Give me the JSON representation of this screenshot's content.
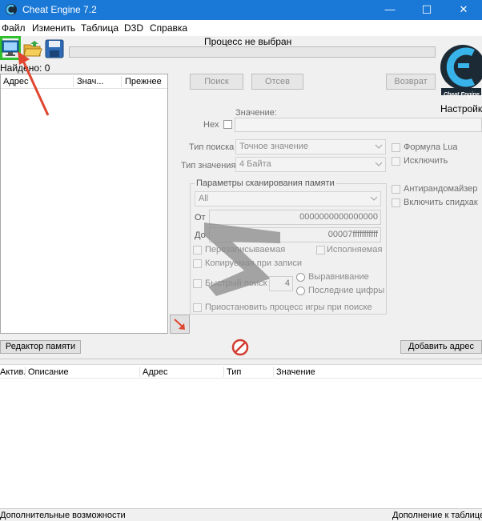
{
  "window": {
    "title": "Cheat Engine 7.2",
    "minimize": "—",
    "maximize": "☐",
    "close": "✕"
  },
  "menu": [
    "Файл",
    "Изменить",
    "Таблица",
    "D3D",
    "Справка"
  ],
  "process_label": "Процесс не выбран",
  "found_label": "Найдено: 0",
  "results_columns": [
    "Адрес",
    "Знач...",
    "Прежнее"
  ],
  "search_buttons": {
    "search": "Поиск",
    "sieve": "Отсев",
    "return": "Возврат"
  },
  "logo_settings": "Настройки",
  "logo_text": "Cheat Engine",
  "value": {
    "label": "Значение:",
    "hex_label": "Hex",
    "input": ""
  },
  "scan_type": {
    "label": "Тип поиска",
    "selected": "Точное значение"
  },
  "value_type": {
    "label": "Тип значения",
    "selected": "4 Байта"
  },
  "right_options": [
    "Формула Lua",
    "Исключить",
    "Антирандомайзер",
    "Включить спидхак"
  ],
  "memory": {
    "title": "Параметры сканирования памяти",
    "region": "All",
    "from_label": "От",
    "from_value": "0000000000000000",
    "to_label": "До",
    "to_value": "00007fffffffffff",
    "writable": "Перезаписываемая",
    "executable": "Исполняемая",
    "copy_on_write": "Копируемая при записи",
    "fast_scan": "Быстрый поиск",
    "fast_scan_value": "4",
    "alignment": "Выравнивание",
    "last_digits": "Последние цифры",
    "pause": "Приостановить процесс игры при поиске"
  },
  "bottom_buttons": {
    "memory_view": "Редактор памяти",
    "add_address": "Добавить адрес"
  },
  "table_columns": [
    "Актив.",
    "Описание",
    "Адрес",
    "Тип",
    "Значение"
  ],
  "status": {
    "left": "Дополнительные возможности",
    "right": "Дополнение к таблице"
  },
  "colors": {
    "titlebar": "#1a78d6",
    "highlight": "#2fbf2f",
    "arrow": "#e0452f"
  }
}
